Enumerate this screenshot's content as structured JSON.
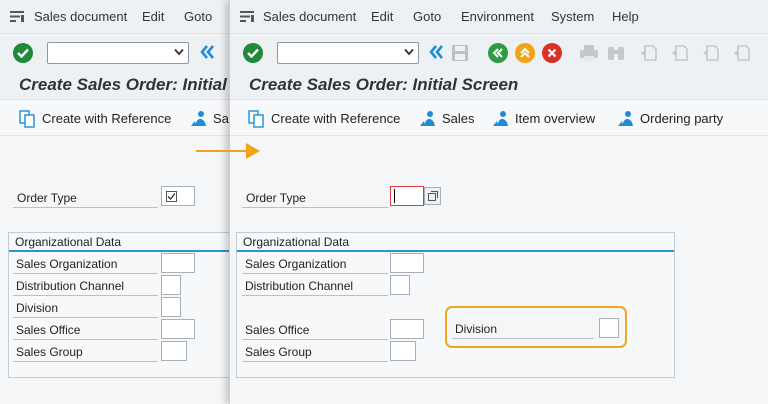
{
  "menu": {
    "items": [
      "Sales document",
      "Edit",
      "Goto",
      "Environment",
      "System",
      "Help"
    ]
  },
  "toolbar": {
    "command_value": ""
  },
  "screen": {
    "title": "Create Sales Order: Initial Screen",
    "title_truncated": "Create Sales Order: Initial"
  },
  "app_toolbar": {
    "create_with_reference": "Create with Reference",
    "sales": "Sales",
    "sales_truncated": "Sal",
    "item_overview": "Item overview",
    "ordering_party": "Ordering party"
  },
  "form": {
    "order_type_label": "Order Type",
    "order_type_value": "",
    "group_title": "Organizational Data",
    "sales_organization_label": "Sales Organization",
    "distribution_channel_label": "Distribution Channel",
    "division_label": "Division",
    "sales_office_label": "Sales Office",
    "sales_group_label": "Sales Group"
  },
  "colors": {
    "ok_green": "#1e8a3a",
    "back_green": "#2f9c44",
    "exit_orange": "#f2a416",
    "cancel_red": "#d9322b",
    "accent_blue": "#1f8dd6",
    "highlight_orange": "#f0a720"
  },
  "icons": [
    "menu-icon",
    "checkmark-icon",
    "dropdown-icon",
    "double-chevron-left-icon",
    "save-icon",
    "back-icon",
    "exit-icon",
    "cancel-icon",
    "print-icon",
    "find-icon",
    "first-page-icon",
    "previous-page-icon",
    "next-page-icon",
    "last-page-icon",
    "create-with-reference-icon",
    "sales-icon",
    "item-overview-icon",
    "ordering-party-icon",
    "value-help-icon",
    "arrow-right-icon"
  ]
}
